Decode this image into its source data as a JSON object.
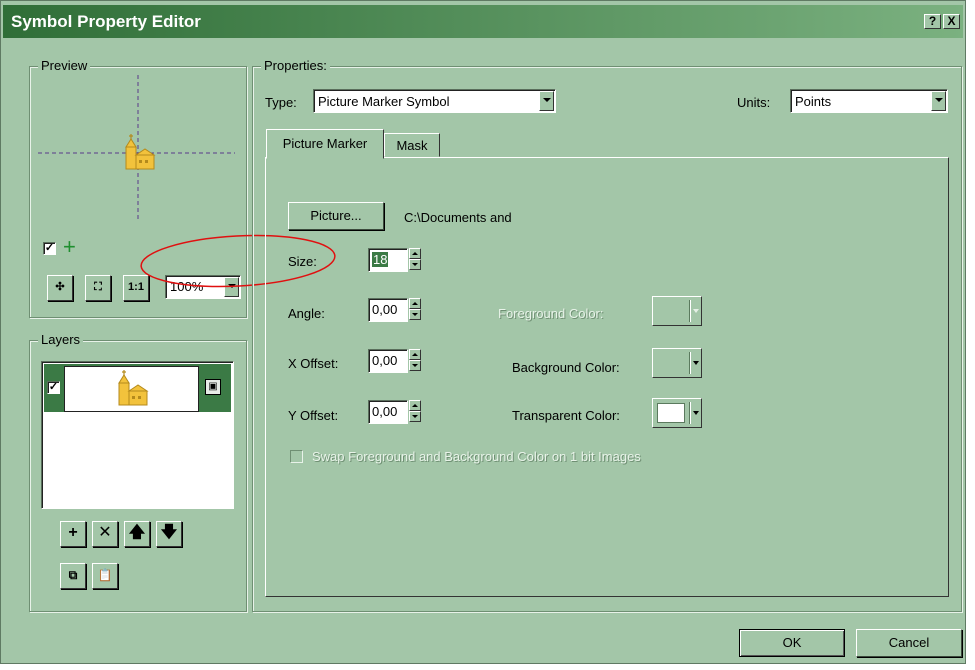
{
  "window": {
    "title": "Symbol Property Editor",
    "help_label": "?",
    "close_label": "X"
  },
  "preview": {
    "group_label": "Preview",
    "zoom_value": "100%"
  },
  "layers": {
    "group_label": "Layers"
  },
  "properties": {
    "group_label": "Properties:",
    "type_label": "Type:",
    "type_value": "Picture Marker Symbol",
    "units_label": "Units:",
    "units_value": "Points",
    "tabs": [
      {
        "label": "Picture Marker"
      },
      {
        "label": "Mask"
      }
    ],
    "picture_button_label": "Picture...",
    "picture_path": "C:\\Documents and",
    "size_label": "Size:",
    "size_value": "18",
    "angle_label": "Angle:",
    "angle_value": "0,00",
    "x_offset_label": "X Offset:",
    "x_offset_value": "0,00",
    "y_offset_label": "Y Offset:",
    "y_offset_value": "0,00",
    "foreground_color_label": "Foreground Color:",
    "background_color_label": "Background Color:",
    "transparent_color_label": "Transparent Color:",
    "swap_checkbox_label": "Swap Foreground and Background Color on 1 bit Images"
  },
  "footer": {
    "ok_label": "OK",
    "cancel_label": "Cancel"
  },
  "colors": {
    "dialog_bg": "#a3c6a8",
    "title_start": "#2f6e37",
    "title_end": "#7bb180",
    "annotation_ellipse": "#e01010",
    "symbol_fill": "#f2c23c"
  }
}
